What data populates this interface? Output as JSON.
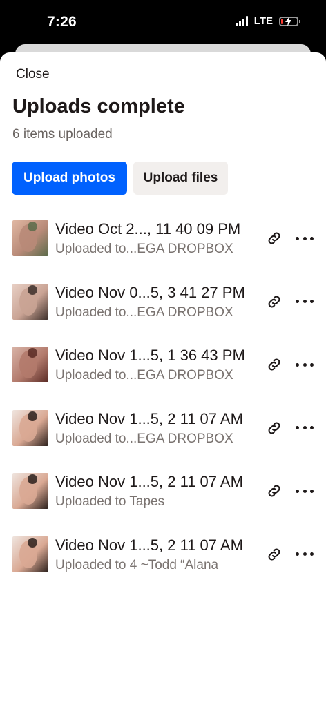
{
  "status_bar": {
    "time": "7:26",
    "network": "LTE",
    "battery_level": 0.15
  },
  "sheet": {
    "close_label": "Close",
    "title": "Uploads complete",
    "subtitle": "6 items uploaded",
    "upload_photos_label": "Upload photos",
    "upload_files_label": "Upload files"
  },
  "uploads": [
    {
      "title": "Video Oct 2..., 11 40 09 PM",
      "subtitle": "Uploaded to...EGA DROPBOX",
      "thumb_colors": [
        "#b88a78",
        "#5b6b4a",
        "#e0b7a2"
      ]
    },
    {
      "title": "Video Nov 0...5, 3 41 27 PM",
      "subtitle": "Uploaded to...EGA DROPBOX",
      "thumb_colors": [
        "#c9a394",
        "#3d2f2a",
        "#e8cfc4"
      ]
    },
    {
      "title": "Video Nov 1...5, 1 36 43 PM",
      "subtitle": "Uploaded to...EGA DROPBOX",
      "thumb_colors": [
        "#b27a6c",
        "#5a2b25",
        "#d8b3a6"
      ]
    },
    {
      "title": "Video Nov 1...5, 2 11 07 AM",
      "subtitle": "Uploaded to...EGA DROPBOX",
      "thumb_colors": [
        "#d9a893",
        "#2b201c",
        "#efe4de"
      ]
    },
    {
      "title": "Video Nov 1...5, 2 11 07 AM",
      "subtitle": "Uploaded to Tapes",
      "thumb_colors": [
        "#d9a893",
        "#2b201c",
        "#efe4de"
      ]
    },
    {
      "title": "Video Nov 1...5, 2 11 07 AM",
      "subtitle": "Uploaded to 4 ~Todd “Alana",
      "thumb_colors": [
        "#d9a893",
        "#2b201c",
        "#efe4de"
      ]
    }
  ],
  "icons": {
    "row_link": "link-icon",
    "row_more": "more-icon"
  },
  "colors": {
    "primary": "#0061fe",
    "secondary_bg": "#f2efed",
    "text": "#1e1919",
    "muted": "#7a7370"
  }
}
